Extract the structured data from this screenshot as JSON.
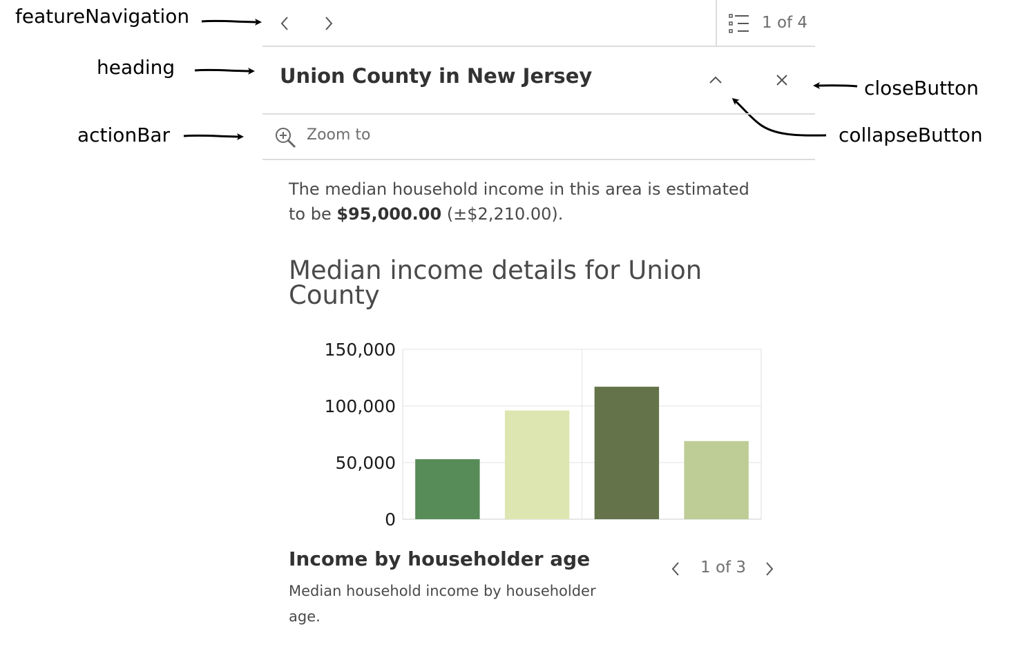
{
  "annotations": {
    "feature_navigation": "featureNavigation",
    "heading": "heading",
    "action_bar": "actionBar",
    "close_button": "closeButton",
    "collapse_button": "collapseButton"
  },
  "feature_navigation": {
    "previous_icon": "chevron-left-icon",
    "next_icon": "chevron-right-icon",
    "list_icon": "list-icon",
    "counter": "1 of 4"
  },
  "header": {
    "title": "Union County in New Jersey",
    "collapse_icon": "chevron-up-icon",
    "close_icon": "close-icon"
  },
  "action_bar": {
    "zoom_icon": "zoom-in-icon",
    "zoom_label": "Zoom to"
  },
  "content": {
    "text_before": "The median household income in this area is estimated",
    "text_second_line_prefix": "to be ",
    "income_value": "$95,000.00",
    "income_margin": " (±$2,210.00).",
    "chart_heading_line1": "Median income details for Union",
    "chart_heading_line2": "County"
  },
  "chart_data": {
    "type": "bar",
    "title": "Income by householder age",
    "description_line1": "Median household income by householder",
    "description_line2": "age.",
    "ylim": [
      0,
      150000
    ],
    "y_ticks": [
      "150,000",
      "100,000",
      "50,000",
      "0"
    ],
    "y_tick_values": [
      150000,
      100000,
      50000,
      0
    ],
    "grid": true,
    "values": [
      53000,
      96000,
      117000,
      69000
    ],
    "colors": [
      "#578c58",
      "#dde6b0",
      "#64734a",
      "#becc96"
    ]
  },
  "media_pager": {
    "counter": "1 of 3",
    "previous_icon": "chevron-left-icon",
    "next_icon": "chevron-right-icon"
  }
}
